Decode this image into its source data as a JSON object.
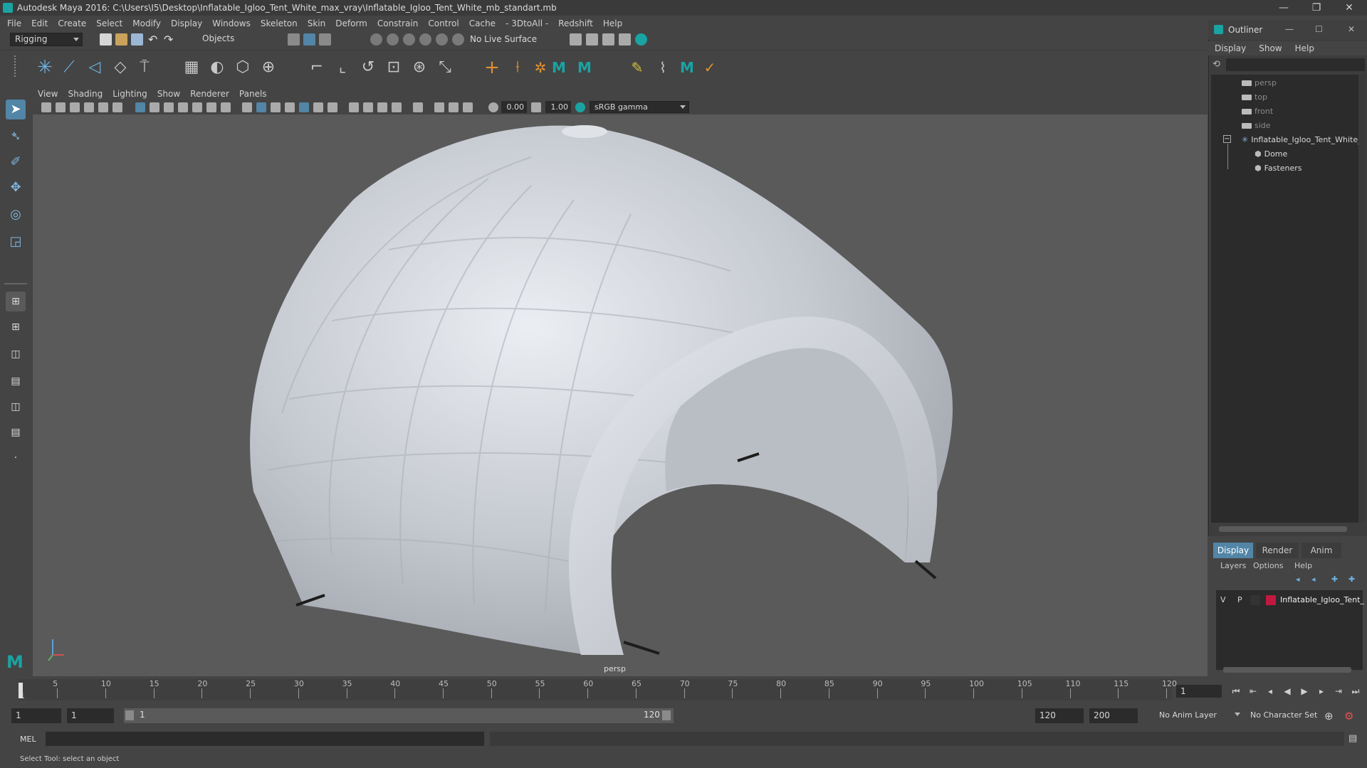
{
  "window": {
    "title": "Autodesk Maya 2016: C:\\Users\\I5\\Desktop\\Inflatable_Igloo_Tent_White_max_vray\\Inflatable_Igloo_Tent_White_mb_standart.mb",
    "minimize": "—",
    "restore": "❐",
    "close": "✕"
  },
  "menubar": [
    "File",
    "Edit",
    "Create",
    "Select",
    "Modify",
    "Display",
    "Windows",
    "Skeleton",
    "Skin",
    "Deform",
    "Constrain",
    "Control",
    "Cache",
    "- 3DtoAll -",
    "Redshift",
    "Help"
  ],
  "statusline": {
    "menuset": "Rigging",
    "selection_mode": "Objects",
    "live_surface": "No Live Surface"
  },
  "viewport": {
    "menus": [
      "View",
      "Shading",
      "Lighting",
      "Show",
      "Renderer",
      "Panels"
    ],
    "exposure": "0.00",
    "gamma": "1.00",
    "color_space": "sRGB gamma",
    "camera_label": "persp"
  },
  "outliner": {
    "title": "Outliner",
    "menus": [
      "Display",
      "Show",
      "Help"
    ],
    "cameras": [
      "persp",
      "top",
      "front",
      "side"
    ],
    "root": "Inflatable_Igloo_Tent_White_",
    "children": [
      "Dome",
      "Fasteners"
    ],
    "minimize": "—",
    "restore": "☐",
    "close": "✕"
  },
  "layer_editor": {
    "tabs": [
      "Display",
      "Render",
      "Anim"
    ],
    "active_tab": "Display",
    "menus": [
      "Layers",
      "Options",
      "Help"
    ],
    "layer": {
      "v": "V",
      "p": "P",
      "name": "Inflatable_Igloo_Tent_",
      "color": "#c01840"
    }
  },
  "timeline": {
    "ticks": [
      "5",
      "10",
      "15",
      "20",
      "25",
      "30",
      "35",
      "40",
      "45",
      "50",
      "55",
      "60",
      "65",
      "70",
      "75",
      "80",
      "85",
      "90",
      "95",
      "100",
      "105",
      "110",
      "115",
      "120"
    ],
    "first_frame_label": "1",
    "current_frame": "1"
  },
  "range": {
    "start": "1",
    "playback_start": "1",
    "slider_start": "1",
    "slider_end": "120",
    "playback_end": "120",
    "end": "200",
    "anim_layer": "No Anim Layer",
    "character_set": "No Character Set"
  },
  "command_line": {
    "label": "MEL"
  },
  "help_line": {
    "text": "Select Tool: select an object"
  },
  "colors": {
    "accent": "#1aa3a3",
    "active_blue": "#5285a6",
    "layer_red": "#c01840"
  }
}
